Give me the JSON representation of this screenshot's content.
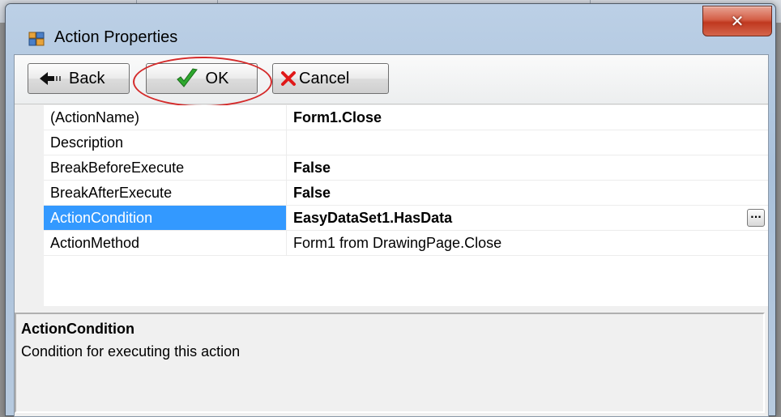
{
  "window": {
    "title": "Action Properties",
    "close_glyph": "✕",
    "icon": "properties-window-icon"
  },
  "toolbar": {
    "back_label": "Back",
    "ok_label": "OK",
    "cancel_label": "Cancel",
    "back_icon": "back-arrow-icon",
    "ok_icon": "green-checkmark-icon",
    "cancel_icon": "red-x-icon"
  },
  "properties": [
    {
      "name": "(ActionName)",
      "value": "Form1.Close",
      "bold": true
    },
    {
      "name": "Description",
      "value": "",
      "bold": false
    },
    {
      "name": "BreakBeforeExecute",
      "value": "False",
      "bold": true
    },
    {
      "name": "BreakAfterExecute",
      "value": "False",
      "bold": true
    },
    {
      "name": "ActionCondition",
      "value": "EasyDataSet1.HasData",
      "bold": true,
      "selected": true,
      "ellipsis": "..."
    },
    {
      "name": "ActionMethod",
      "value": "Form1 from DrawingPage.Close",
      "bold": false
    }
  ],
  "help": {
    "title": "ActionCondition",
    "description": "Condition for executing this action"
  },
  "colors": {
    "selection": "#3399ff",
    "highlight_circle": "#d42a2a",
    "close_button": "#c0381f"
  }
}
